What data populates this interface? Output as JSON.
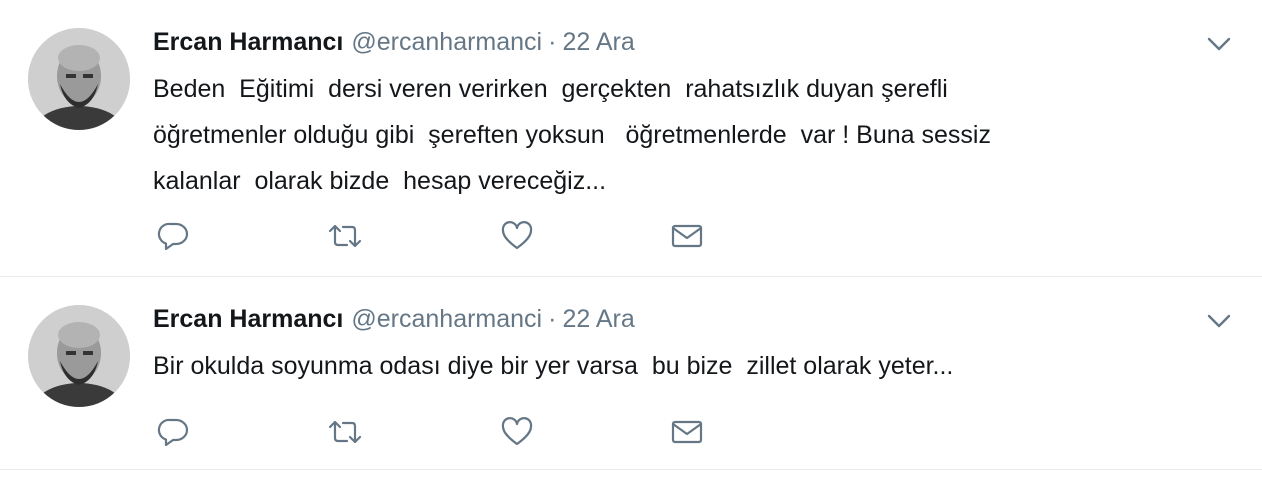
{
  "colors": {
    "text": "#14171a",
    "secondary": "#657786",
    "divider": "#e6ecf0"
  },
  "tweets": [
    {
      "name": "Ercan Harmancı",
      "handle": "@ercanharmanci",
      "separator": "·",
      "date": "22 Ara",
      "text": "Beden  Eğitimi  dersi veren verirken  gerçekten  rahatsızlık duyan şerefli\nöğretmenler olduğu gibi  şereften yoksun   öğretmenlerde  var ! Buna sessiz\nkalanlar  olarak bizde  hesap vereceğiz...",
      "icons": [
        "reply-icon",
        "retweet-icon",
        "like-icon",
        "direct-message-icon"
      ]
    },
    {
      "name": "Ercan Harmancı",
      "handle": "@ercanharmanci",
      "separator": "·",
      "date": "22 Ara",
      "text": "Bir okulda soyunma odası diye bir yer varsa  bu bize  zillet olarak yeter...",
      "icons": [
        "reply-icon",
        "retweet-icon",
        "like-icon",
        "direct-message-icon"
      ]
    }
  ]
}
